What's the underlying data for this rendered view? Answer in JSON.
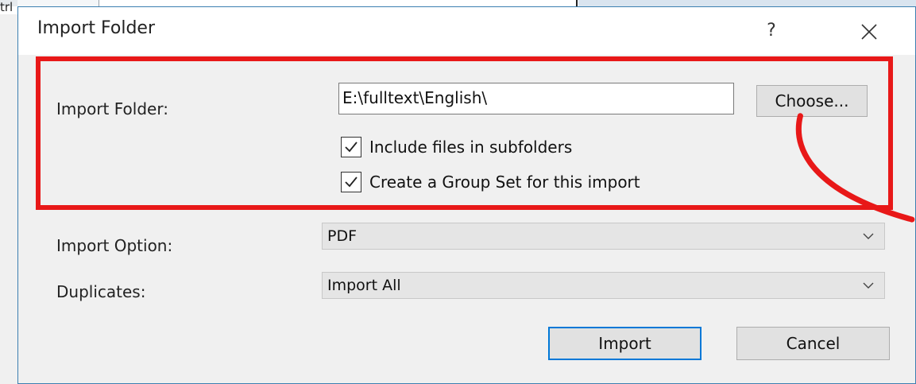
{
  "background": {
    "ctrl_text": "trl"
  },
  "dialog": {
    "title": "Import Folder",
    "help_glyph": "?",
    "close_icon": "close-icon",
    "accent_color": "#0078d7",
    "highlight_color": "#e81818"
  },
  "import_folder": {
    "label": "Import Folder:",
    "path": "E:\\fulltext\\English\\",
    "choose_label": "Choose...",
    "include_subfolders": {
      "label": "Include files in subfolders",
      "checked": true
    },
    "create_group_set": {
      "label": "Create a Group Set for this import",
      "checked": true
    }
  },
  "import_option": {
    "label": "Import Option:",
    "selected": "PDF"
  },
  "duplicates": {
    "label": "Duplicates:",
    "selected": "Import All"
  },
  "buttons": {
    "import": "Import",
    "cancel": "Cancel"
  }
}
